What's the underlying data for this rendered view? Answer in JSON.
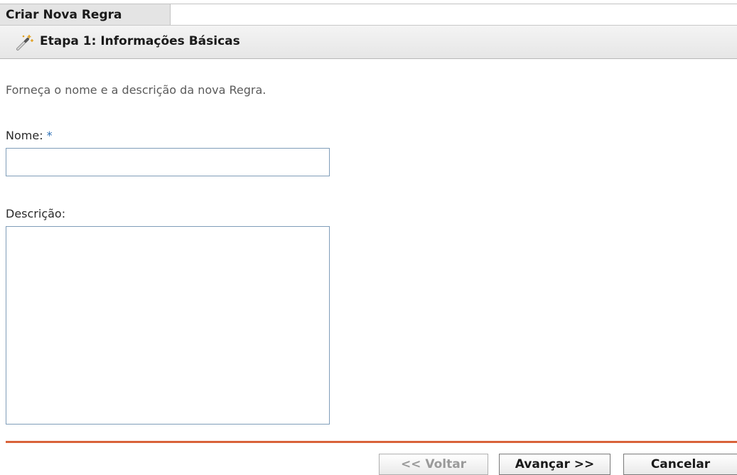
{
  "header": {
    "title": "Criar Nova Regra",
    "step_title": "Etapa 1: Informações Básicas",
    "step_icon": "wand-icon"
  },
  "instructions": "Forneça o nome e a descrição da nova Regra.",
  "form": {
    "name_label": "Nome:",
    "name_required_marker": "*",
    "name_value": "",
    "description_label": "Descrição:",
    "description_value": ""
  },
  "buttons": {
    "back_label": "<< Voltar",
    "back_enabled": false,
    "next_label": "Avançar >>",
    "cancel_label": "Cancelar"
  },
  "colors": {
    "divider": "#d9633a",
    "required": "#2b6fb5",
    "input_border": "#7f9db9"
  }
}
